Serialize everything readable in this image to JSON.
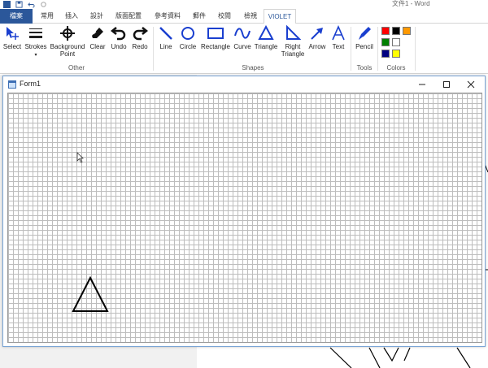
{
  "titlebar": {
    "doc_title": "文件1 - Word"
  },
  "tabs": [
    {
      "label": "檔案"
    },
    {
      "label": "常用"
    },
    {
      "label": "插入"
    },
    {
      "label": "設計"
    },
    {
      "label": "版面配置"
    },
    {
      "label": "參考資料"
    },
    {
      "label": "郵件"
    },
    {
      "label": "校閱"
    },
    {
      "label": "檢視"
    },
    {
      "label": "VIOLET"
    }
  ],
  "ribbon": {
    "other": {
      "label": "Other",
      "select": "Select",
      "strokes": "Strokes",
      "strokes_arrow": "▾",
      "background": "Background",
      "background2": "Point",
      "clear": "Clear",
      "undo": "Undo",
      "redo": "Redo"
    },
    "shapes": {
      "label": "Shapes",
      "line": "Line",
      "circle": "Circle",
      "rectangle": "Rectangle",
      "curve": "Curve",
      "triangle": "Triangle",
      "right_triangle": "Right",
      "right_triangle2": "Triangle",
      "arrow": "Arrow",
      "text": "Text"
    },
    "tools": {
      "label": "Tools",
      "pencil": "Pencil"
    },
    "colors": {
      "label": "Colors",
      "swatches": [
        "#ff0000",
        "#000000",
        "#ff9900",
        "#008000",
        "#ffffff",
        "#000080",
        "#ffff00"
      ]
    },
    "accent": "#2b579a",
    "icon_blue": "#1a3fcf"
  },
  "form": {
    "title": "Form1"
  }
}
